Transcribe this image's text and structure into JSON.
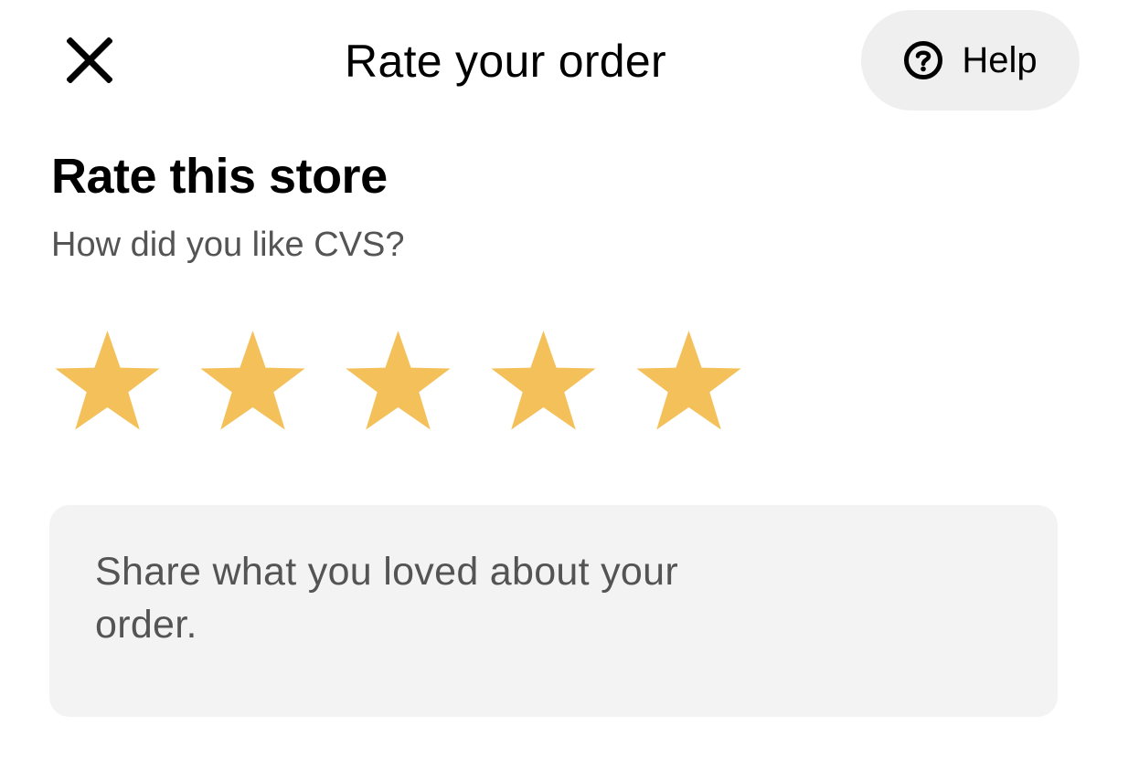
{
  "header": {
    "title": "Rate your order",
    "close_icon": "close-icon",
    "help_label": "Help",
    "help_icon": "question-circle-icon"
  },
  "store_rating": {
    "title": "Rate this store",
    "subtitle": "How did you like CVS?",
    "rating": 5,
    "max_rating": 5,
    "star_icon": "star-icon",
    "star_color": "#F4C05A"
  },
  "comment": {
    "placeholder": "Share what you loved about your order."
  },
  "colors": {
    "help_button_bg": "#EFEFEF",
    "comment_box_bg": "#F3F3F3",
    "secondary_text": "#545454"
  }
}
